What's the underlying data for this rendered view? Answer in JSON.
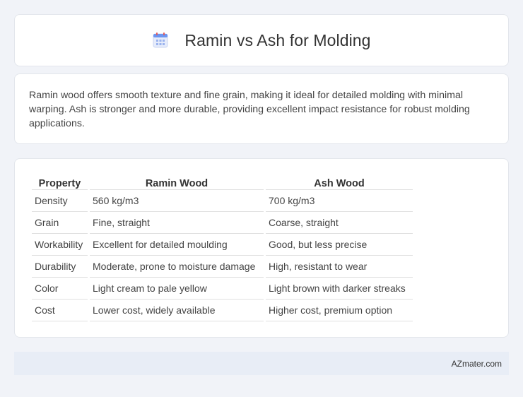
{
  "header": {
    "title": "Ramin vs Ash for Molding",
    "icon": "calendar-icon"
  },
  "description": {
    "text": "Ramin wood offers smooth texture and fine grain, making it ideal for detailed molding with minimal warping. Ash is stronger and more durable, providing excellent impact resistance for robust molding applications."
  },
  "table": {
    "headers": [
      "Property",
      "Ramin Wood",
      "Ash Wood"
    ],
    "rows": [
      [
        "Density",
        "560 kg/m3",
        "700 kg/m3"
      ],
      [
        "Grain",
        "Fine, straight",
        "Coarse, straight"
      ],
      [
        "Workability",
        "Excellent for detailed moulding",
        "Good, but less precise"
      ],
      [
        "Durability",
        "Moderate, prone to moisture damage",
        "High, resistant to wear"
      ],
      [
        "Color",
        "Light cream to pale yellow",
        "Light brown with darker streaks"
      ],
      [
        "Cost",
        "Lower cost, widely available",
        "Higher cost, premium option"
      ]
    ]
  },
  "footer": {
    "site": "AZmater.com"
  },
  "colors": {
    "page_bg": "#f1f3f8",
    "card_bg": "#ffffff",
    "footer_bg": "#e8edf6",
    "icon_blue": "#5b8def",
    "icon_red": "#e45b5b"
  }
}
